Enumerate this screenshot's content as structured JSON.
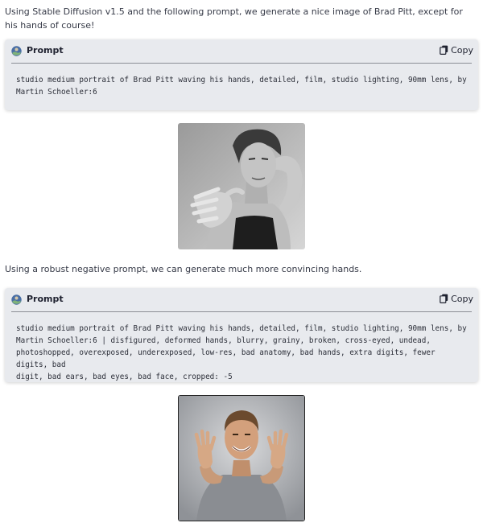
{
  "intro": {
    "text": "Using Stable Diffusion v1.5 and the following prompt, we generate a nice image of Brad Pitt, except for his hands of course!"
  },
  "prompt1": {
    "title": "Prompt",
    "copy_label": "Copy",
    "text": "studio medium portrait of Brad Pitt waving his hands, detailed, film, studio lighting, 90mm lens, by\nMartin Schoeller:6"
  },
  "middle": {
    "text": "Using a robust negative prompt, we can generate much more convincing hands."
  },
  "prompt2": {
    "title": "Prompt",
    "copy_label": "Copy",
    "text": "studio medium portrait of Brad Pitt waving his hands, detailed, film, studio lighting, 90mm lens, by\nMartin Schoeller:6 | disfigured, deformed hands, blurry, grainy, broken, cross-eyed, undead,\nphotoshopped, overexposed, underexposed, low-res, bad anatomy, bad hands, extra digits, fewer digits, bad\ndigit, bad ears, bad eyes, bad face, cropped: -5"
  },
  "icons": {
    "prompt": "globe-avatar-icon",
    "copy": "copy-icon"
  },
  "colors": {
    "card_bg": "#e8eaee",
    "text": "#363a47"
  }
}
